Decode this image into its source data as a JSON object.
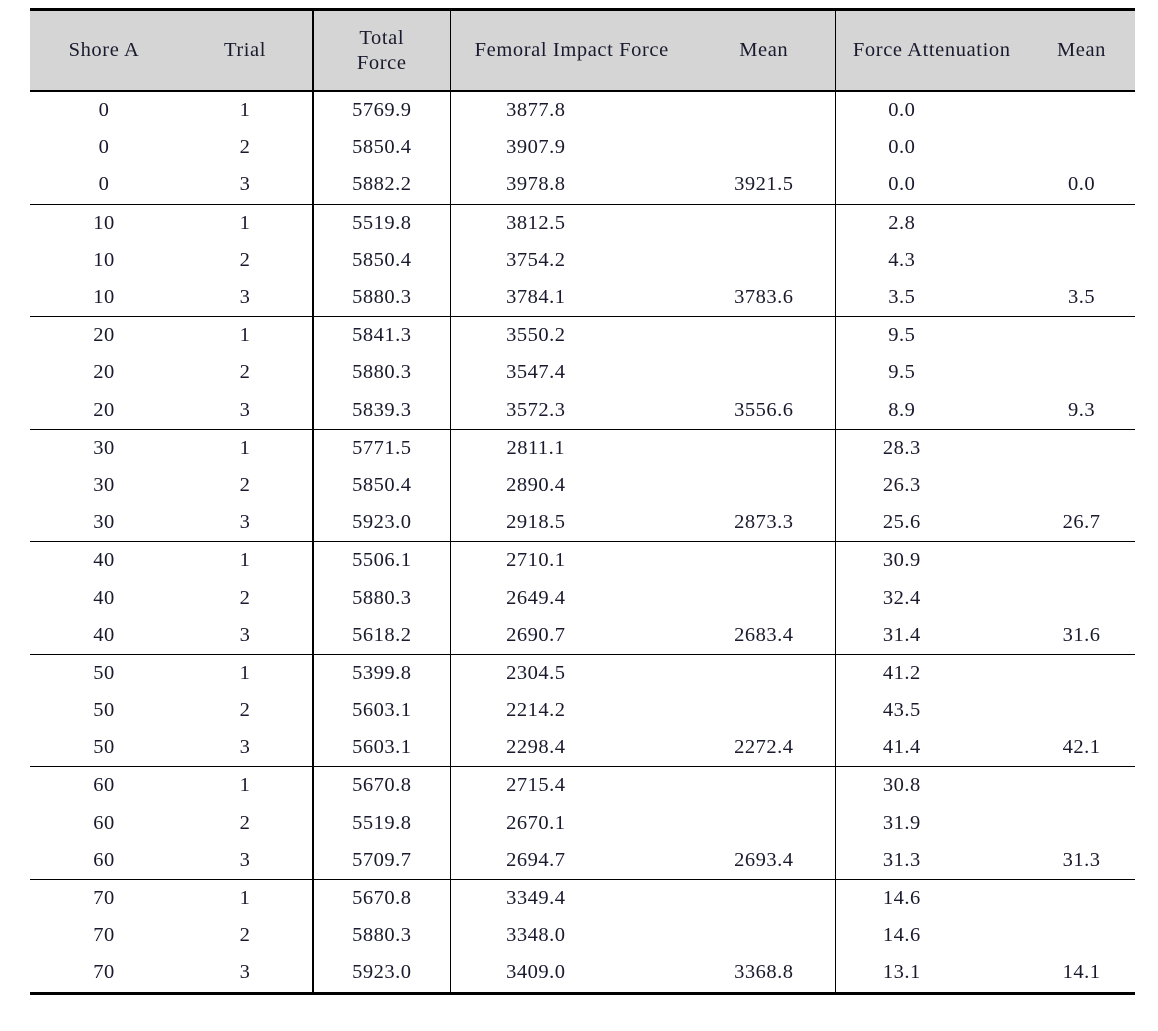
{
  "table": {
    "columns": [
      {
        "key": "shore",
        "label": "Shore A"
      },
      {
        "key": "trial",
        "label": "Trial"
      },
      {
        "key": "total",
        "label_line1": "Total",
        "label_line2": "Force"
      },
      {
        "key": "femoral",
        "label": "Femoral Impact Force"
      },
      {
        "key": "fem_mean",
        "label": "Mean"
      },
      {
        "key": "atten",
        "label": "Force Attenuation"
      },
      {
        "key": "atten_mean",
        "label": "Mean"
      }
    ],
    "groups": [
      {
        "shore": "0",
        "rows": [
          {
            "shore": "0",
            "trial": "1",
            "total": "5769.9",
            "femoral": "3877.8",
            "fem_mean": "",
            "atten": "0.0",
            "atten_mean": ""
          },
          {
            "shore": "0",
            "trial": "2",
            "total": "5850.4",
            "femoral": "3907.9",
            "fem_mean": "",
            "atten": "0.0",
            "atten_mean": ""
          },
          {
            "shore": "0",
            "trial": "3",
            "total": "5882.2",
            "femoral": "3978.8",
            "fem_mean": "3921.5",
            "atten": "0.0",
            "atten_mean": "0.0"
          }
        ]
      },
      {
        "shore": "10",
        "rows": [
          {
            "shore": "10",
            "trial": "1",
            "total": "5519.8",
            "femoral": "3812.5",
            "fem_mean": "",
            "atten": "2.8",
            "atten_mean": ""
          },
          {
            "shore": "10",
            "trial": "2",
            "total": "5850.4",
            "femoral": "3754.2",
            "fem_mean": "",
            "atten": "4.3",
            "atten_mean": ""
          },
          {
            "shore": "10",
            "trial": "3",
            "total": "5880.3",
            "femoral": "3784.1",
            "fem_mean": "3783.6",
            "atten": "3.5",
            "atten_mean": "3.5"
          }
        ]
      },
      {
        "shore": "20",
        "rows": [
          {
            "shore": "20",
            "trial": "1",
            "total": "5841.3",
            "femoral": "3550.2",
            "fem_mean": "",
            "atten": "9.5",
            "atten_mean": ""
          },
          {
            "shore": "20",
            "trial": "2",
            "total": "5880.3",
            "femoral": "3547.4",
            "fem_mean": "",
            "atten": "9.5",
            "atten_mean": ""
          },
          {
            "shore": "20",
            "trial": "3",
            "total": "5839.3",
            "femoral": "3572.3",
            "fem_mean": "3556.6",
            "atten": "8.9",
            "atten_mean": "9.3"
          }
        ]
      },
      {
        "shore": "30",
        "rows": [
          {
            "shore": "30",
            "trial": "1",
            "total": "5771.5",
            "femoral": "2811.1",
            "fem_mean": "",
            "atten": "28.3",
            "atten_mean": ""
          },
          {
            "shore": "30",
            "trial": "2",
            "total": "5850.4",
            "femoral": "2890.4",
            "fem_mean": "",
            "atten": "26.3",
            "atten_mean": ""
          },
          {
            "shore": "30",
            "trial": "3",
            "total": "5923.0",
            "femoral": "2918.5",
            "fem_mean": "2873.3",
            "atten": "25.6",
            "atten_mean": "26.7"
          }
        ]
      },
      {
        "shore": "40",
        "rows": [
          {
            "shore": "40",
            "trial": "1",
            "total": "5506.1",
            "femoral": "2710.1",
            "fem_mean": "",
            "atten": "30.9",
            "atten_mean": ""
          },
          {
            "shore": "40",
            "trial": "2",
            "total": "5880.3",
            "femoral": "2649.4",
            "fem_mean": "",
            "atten": "32.4",
            "atten_mean": ""
          },
          {
            "shore": "40",
            "trial": "3",
            "total": "5618.2",
            "femoral": "2690.7",
            "fem_mean": "2683.4",
            "atten": "31.4",
            "atten_mean": "31.6"
          }
        ]
      },
      {
        "shore": "50",
        "rows": [
          {
            "shore": "50",
            "trial": "1",
            "total": "5399.8",
            "femoral": "2304.5",
            "fem_mean": "",
            "atten": "41.2",
            "atten_mean": ""
          },
          {
            "shore": "50",
            "trial": "2",
            "total": "5603.1",
            "femoral": "2214.2",
            "fem_mean": "",
            "atten": "43.5",
            "atten_mean": ""
          },
          {
            "shore": "50",
            "trial": "3",
            "total": "5603.1",
            "femoral": "2298.4",
            "fem_mean": "2272.4",
            "atten": "41.4",
            "atten_mean": "42.1"
          }
        ]
      },
      {
        "shore": "60",
        "rows": [
          {
            "shore": "60",
            "trial": "1",
            "total": "5670.8",
            "femoral": "2715.4",
            "fem_mean": "",
            "atten": "30.8",
            "atten_mean": ""
          },
          {
            "shore": "60",
            "trial": "2",
            "total": "5519.8",
            "femoral": "2670.1",
            "fem_mean": "",
            "atten": "31.9",
            "atten_mean": ""
          },
          {
            "shore": "60",
            "trial": "3",
            "total": "5709.7",
            "femoral": "2694.7",
            "fem_mean": "2693.4",
            "atten": "31.3",
            "atten_mean": "31.3"
          }
        ]
      },
      {
        "shore": "70",
        "rows": [
          {
            "shore": "70",
            "trial": "1",
            "total": "5670.8",
            "femoral": "3349.4",
            "fem_mean": "",
            "atten": "14.6",
            "atten_mean": ""
          },
          {
            "shore": "70",
            "trial": "2",
            "total": "5880.3",
            "femoral": "3348.0",
            "fem_mean": "",
            "atten": "14.6",
            "atten_mean": ""
          },
          {
            "shore": "70",
            "trial": "3",
            "total": "5923.0",
            "femoral": "3409.0",
            "fem_mean": "3368.8",
            "atten": "13.1",
            "atten_mean": "14.1"
          }
        ]
      }
    ]
  },
  "style": {
    "header_background": "#d5d5d5",
    "rule_color": "#000000",
    "text_color": "#1a1a2e",
    "page_background": "#ffffff"
  }
}
